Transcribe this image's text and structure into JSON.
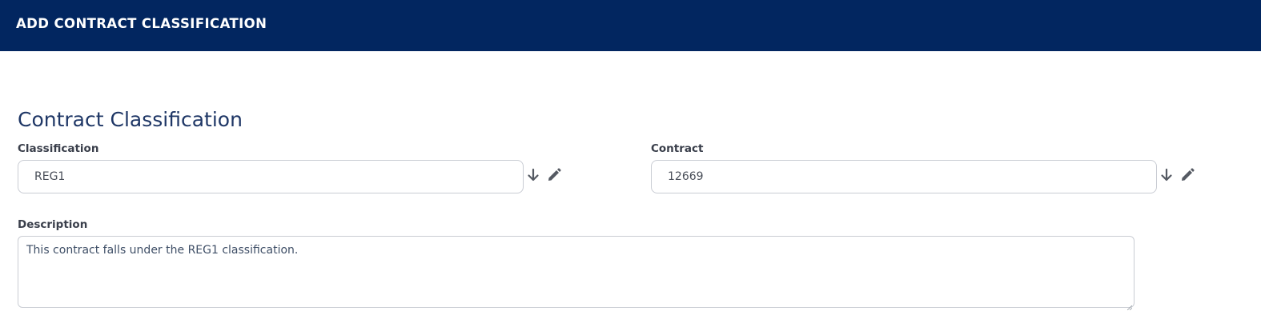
{
  "header": {
    "title": "ADD CONTRACT CLASSIFICATION",
    "background_color": "#022660"
  },
  "section": {
    "title": "Contract Classification"
  },
  "fields": {
    "classification": {
      "label": "Classification",
      "value": "REG1"
    },
    "contract": {
      "label": "Contract",
      "value": "12669"
    },
    "description": {
      "label": "Description",
      "value": "This contract falls under the REG1 classification."
    }
  },
  "icons": {
    "lookup": "arrow-down-icon",
    "edit": "pencil-icon"
  }
}
